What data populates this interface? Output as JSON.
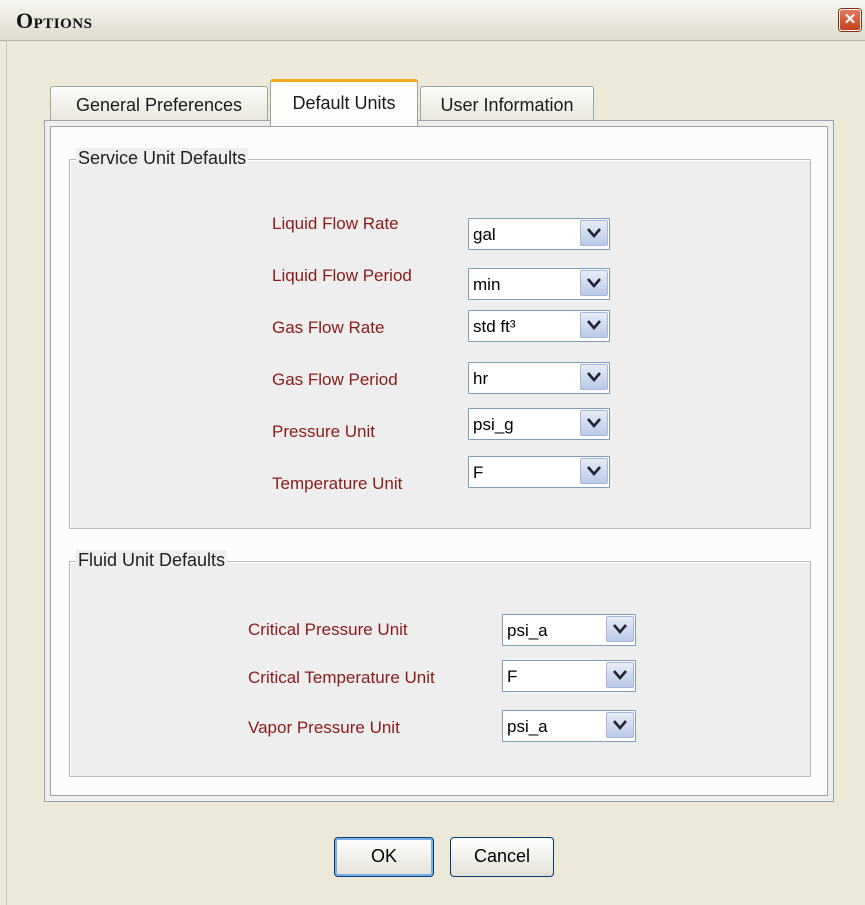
{
  "window": {
    "title": "Options",
    "close_glyph": "✕"
  },
  "tabs": [
    {
      "label": "General Preferences"
    },
    {
      "label": "Default Units",
      "selected": true
    },
    {
      "label": "User Information"
    }
  ],
  "service": {
    "legend": "Service Unit Defaults",
    "fields": [
      {
        "label": "Liquid Flow Rate",
        "value": "gal"
      },
      {
        "label": "Liquid Flow Period",
        "value": "min"
      },
      {
        "label": "Gas Flow Rate",
        "value": "std ft³"
      },
      {
        "label": "Gas Flow Period",
        "value": "hr"
      },
      {
        "label": "Pressure Unit",
        "value": "psi_g"
      },
      {
        "label": "Temperature Unit",
        "value": "F"
      }
    ]
  },
  "fluid": {
    "legend": "Fluid Unit Defaults",
    "fields": [
      {
        "label": "Critical Pressure Unit",
        "value": "psi_a"
      },
      {
        "label": "Critical Temperature Unit",
        "value": "F"
      },
      {
        "label": "Vapor Pressure Unit",
        "value": "psi_a"
      }
    ]
  },
  "buttons": {
    "ok": "OK",
    "cancel": "Cancel"
  },
  "colors": {
    "label": "#8b1a1a",
    "tab_accent": "#f6a71a",
    "close": "#c1401b"
  },
  "icons": {
    "dropdown": "chevron-down-icon",
    "close": "close-icon"
  }
}
